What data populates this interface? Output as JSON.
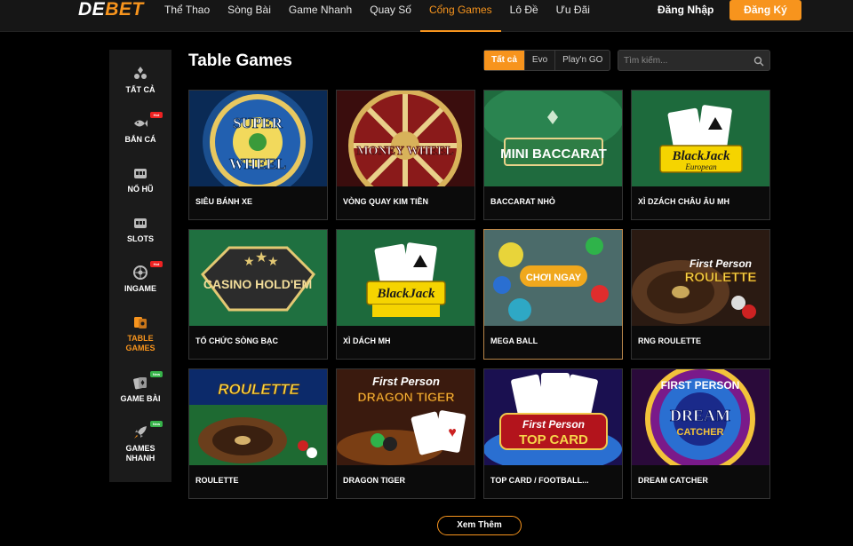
{
  "header": {
    "logo_part1": "DE",
    "logo_part2": "BET",
    "nav": [
      {
        "label": "Thể Thao"
      },
      {
        "label": "Sòng Bài"
      },
      {
        "label": "Game Nhanh"
      },
      {
        "label": "Quay Số"
      },
      {
        "label": "Cổng Games"
      },
      {
        "label": "Lô Đề"
      },
      {
        "label": "Ưu Đãi"
      }
    ],
    "active_nav": "Cổng Games",
    "login_label": "Đăng Nhập",
    "register_label": "Đăng Ký"
  },
  "sidebar": {
    "items": [
      {
        "label": "TẤT CẢ",
        "icon": "cards-suits-icon"
      },
      {
        "label": "BẮN CÁ",
        "icon": "fish-icon",
        "badge": "Hot"
      },
      {
        "label": "NỔ HŨ",
        "icon": "slot-machine-icon"
      },
      {
        "label": "SLOTS",
        "icon": "slot-machine-icon"
      },
      {
        "label": "INGAME",
        "icon": "wheel-icon",
        "badge": "Hot"
      },
      {
        "label": "TABLE GAMES",
        "icon": "table-games-icon"
      },
      {
        "label": "GAME BÀI",
        "icon": "card-game-icon",
        "badge": "New"
      },
      {
        "label": "GAMES NHANH",
        "icon": "rocket-icon",
        "badge": "New"
      }
    ],
    "active": "TABLE GAMES"
  },
  "main": {
    "title": "Table Games",
    "filters": [
      {
        "label": "Tất cả"
      },
      {
        "label": "Evo"
      },
      {
        "label": "Play'n GO"
      }
    ],
    "active_filter": "Tất cả",
    "search_placeholder": "Tìm kiếm...",
    "games": [
      {
        "label": "SIÊU BÁNH XE",
        "art_text": "SUPER WHEEL"
      },
      {
        "label": "VÒNG QUAY KIM TIỀN",
        "art_text": "MONEY WHEEL"
      },
      {
        "label": "BACCARAT NHỎ",
        "art_text": "MINI BACCARAT"
      },
      {
        "label": "XÌ DZÁCH CHÂU ÂU MH",
        "art_text": "BlackJack European"
      },
      {
        "label": "TỔ CHỨC SÒNG BẠC",
        "art_text": "CASINO HOLD'EM"
      },
      {
        "label": "XÌ DÁCH MH",
        "art_text": "BlackJack"
      },
      {
        "label": "MEGA BALL",
        "art_text": "CHƠI NGAY"
      },
      {
        "label": "RNG ROULETTE",
        "art_text": "First Person ROULETTE"
      },
      {
        "label": "ROULETTE",
        "art_text": "ROULETTE"
      },
      {
        "label": "DRAGON TIGER",
        "art_text": "First Person DRAGON TIGER"
      },
      {
        "label": "TOP CARD / FOOTBALL...",
        "art_text": "First Person TOP CARD"
      },
      {
        "label": "DREAM CATCHER",
        "art_text": "FIRST PERSON DREAM CATCHER"
      }
    ],
    "more_label": "Xem Thêm"
  },
  "colors": {
    "accent": "#f7941d",
    "background": "#000000",
    "header": "#161616",
    "sidebar": "#1b1b1b",
    "hot_badge": "#e22222",
    "new_badge": "#37b34a"
  }
}
